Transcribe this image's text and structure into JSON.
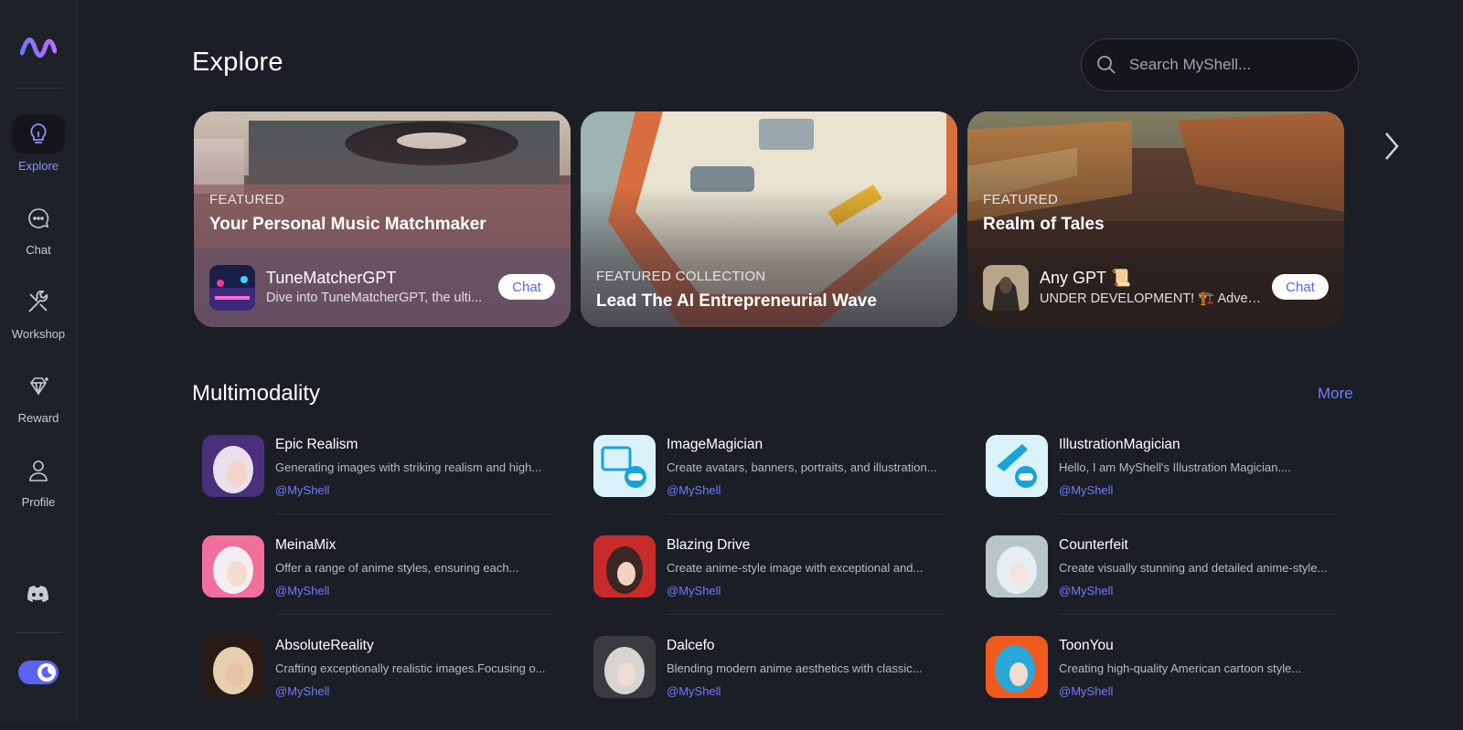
{
  "sidebar": {
    "items": [
      {
        "label": "Explore",
        "icon": "lightbulb-icon",
        "active": true
      },
      {
        "label": "Chat",
        "icon": "chat-bubble-icon"
      },
      {
        "label": "Workshop",
        "icon": "tools-icon"
      },
      {
        "label": "Reward",
        "icon": "diamond-icon"
      },
      {
        "label": "Profile",
        "icon": "user-icon"
      }
    ],
    "discord_icon": "discord-icon",
    "theme_toggle_icon": "moon-icon"
  },
  "header": {
    "title": "Explore",
    "search_placeholder": "Search MyShell..."
  },
  "banners": [
    {
      "tag": "FEATURED",
      "title": "Your Personal Music Matchmaker",
      "bot_name": "TuneMatcherGPT",
      "bot_desc": "Dive into TuneMatcherGPT, the ulti...",
      "button": "Chat"
    },
    {
      "tag": "FEATURED COLLECTION",
      "title": "Lead The AI Entrepreneurial Wave"
    },
    {
      "tag": "FEATURED",
      "title": "Realm of Tales",
      "bot_name": "Any GPT 📜",
      "bot_desc": "UNDER DEVELOPMENT! 🏗️ Advent...",
      "button": "Chat"
    }
  ],
  "section": {
    "title": "Multimodality",
    "more": "More"
  },
  "bots": [
    {
      "name": "Epic Realism",
      "desc": "Generating images with striking realism and high...",
      "author": "@MyShell"
    },
    {
      "name": "ImageMagician",
      "desc": "Create avatars, banners, portraits, and illustration...",
      "author": "@MyShell"
    },
    {
      "name": "IllustrationMagician",
      "desc": "Hello, I am MyShell's Illustration Magician....",
      "author": "@MyShell"
    },
    {
      "name": "MeinaMix",
      "desc": "Offer a range of anime styles, ensuring each...",
      "author": "@MyShell"
    },
    {
      "name": "Blazing Drive",
      "desc": "Create anime-style image with exceptional and...",
      "author": "@MyShell"
    },
    {
      "name": "Counterfeit",
      "desc": "Create visually stunning and detailed anime-style...",
      "author": "@MyShell"
    },
    {
      "name": "AbsoluteReality",
      "desc": "Crafting exceptionally realistic images.Focusing o...",
      "author": "@MyShell"
    },
    {
      "name": "Dalcefo",
      "desc": "Blending modern anime aesthetics with classic...",
      "author": "@MyShell"
    },
    {
      "name": "ToonYou",
      "desc": "Creating high-quality American cartoon style...",
      "author": "@MyShell"
    }
  ],
  "colors": {
    "background": "#1c1e26",
    "accent": "#6f7cff",
    "toggle": "#5b63f2"
  }
}
